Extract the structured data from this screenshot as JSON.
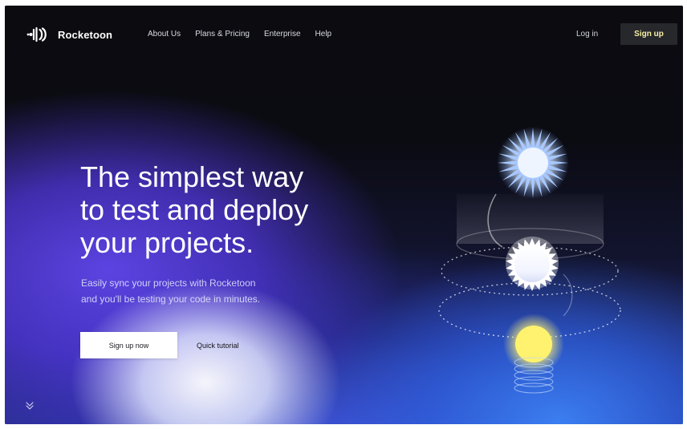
{
  "brand": {
    "name": "Rocketoon",
    "logo_icon": "rocket-waves-logo"
  },
  "nav": {
    "links": [
      "About Us",
      "Plans & Pricing",
      "Enterprise",
      "Help"
    ],
    "login": "Log in",
    "signup": "Sign up"
  },
  "hero": {
    "title_lines": [
      "The simplest way",
      "to test and deploy",
      "your projects."
    ],
    "subtitle_lines": [
      "Easily sync your projects with Rocketoon",
      "and you'll be testing your code in minutes."
    ],
    "primary_cta": "Sign up now",
    "secondary_cta": "Quick tutorial"
  },
  "scroll": {
    "icon": "double-chevron-down-icon"
  },
  "colors": {
    "signup_text": "#f7f0a2",
    "signup_bg": "#26282c",
    "hero_blue": "#4d3fe0",
    "sun_yellow": "#fff26e"
  }
}
